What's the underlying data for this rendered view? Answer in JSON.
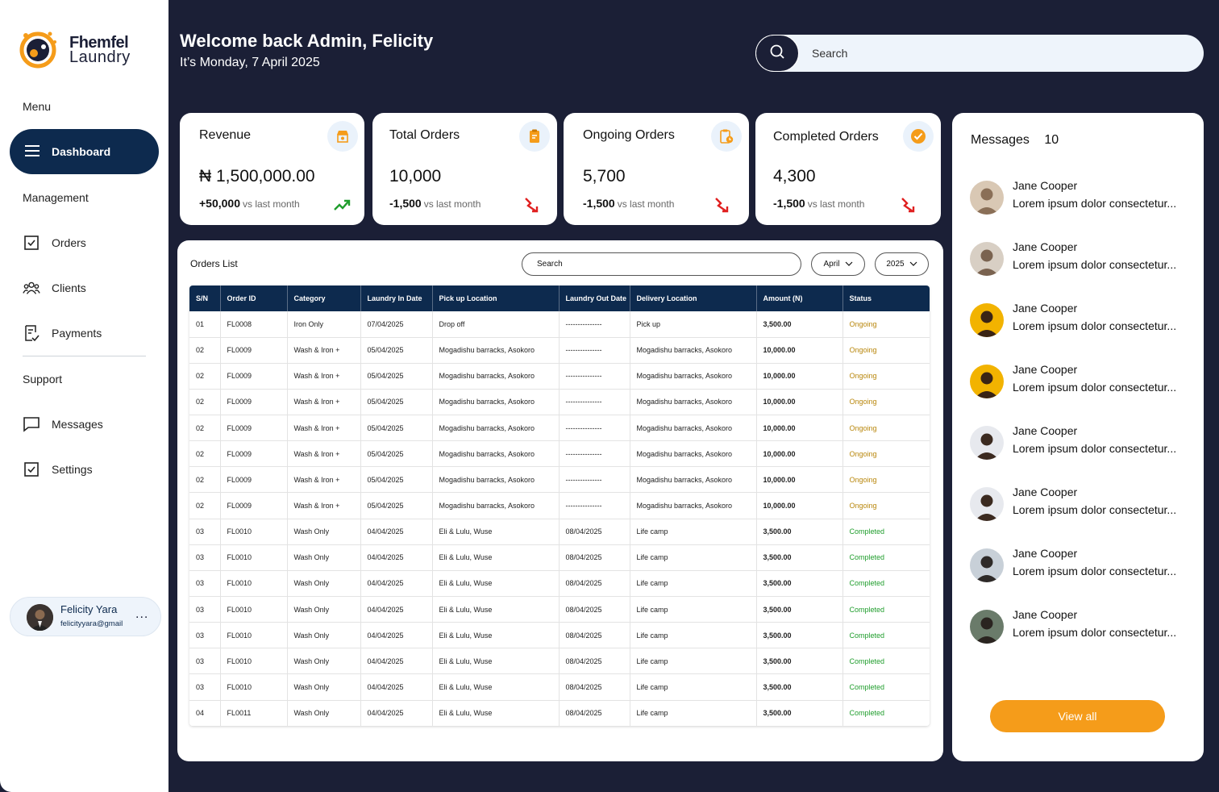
{
  "brand": {
    "line1": "Fhemfel",
    "line2": "Laundry"
  },
  "sidebar": {
    "menu_label": "Menu",
    "dashboard_label": "Dashboard",
    "management_label": "Management",
    "orders_label": "Orders",
    "clients_label": "Clients",
    "payments_label": "Payments",
    "support_label": "Support",
    "messages_label": "Messages",
    "settings_label": "Settings"
  },
  "user": {
    "name": "Felicity Yara",
    "email": "felicityyara@gmail",
    "more": "..."
  },
  "header": {
    "welcome": "Welcome back Admin, Felicity",
    "date": "It’s Monday, 7 April 2025",
    "search_placeholder": "Search"
  },
  "stats": [
    {
      "title": "Revenue",
      "value": "₦ 1,500,000.00",
      "delta": "+50,000",
      "vs": "vs last month",
      "trend": "up",
      "icon": "shop-icon"
    },
    {
      "title": "Total Orders",
      "value": "10,000",
      "delta": "-1,500",
      "vs": "vs last month",
      "trend": "down",
      "icon": "clipboard-icon"
    },
    {
      "title": "Ongoing Orders",
      "value": "5,700",
      "delta": "-1,500",
      "vs": "vs last month",
      "trend": "down",
      "icon": "clipboard-clock-icon"
    },
    {
      "title": "Completed Orders",
      "value": "4,300",
      "delta": "-1,500",
      "vs": "vs last month",
      "trend": "down",
      "icon": "check-circle-icon"
    }
  ],
  "orders": {
    "title": "Orders List",
    "search_placeholder": "Search",
    "month": "April",
    "year": "2025",
    "columns": [
      "S/N",
      "Order ID",
      "Category",
      "Laundry In Date",
      "Pick up Location",
      "Laundry Out Date",
      "Delivery Location",
      "Amount (N)",
      "Status"
    ],
    "rows": [
      [
        "01",
        "FL0008",
        "Iron Only",
        "07/04/2025",
        "Drop off",
        "---------------",
        "Pick up",
        "3,500.00",
        "Ongoing"
      ],
      [
        "02",
        "FL0009",
        "Wash & Iron +",
        "05/04/2025",
        "Mogadishu barracks, Asokoro",
        "---------------",
        "Mogadishu barracks, Asokoro",
        "10,000.00",
        "Ongoing"
      ],
      [
        "02",
        "FL0009",
        "Wash & Iron +",
        "05/04/2025",
        "Mogadishu barracks, Asokoro",
        "---------------",
        "Mogadishu barracks, Asokoro",
        "10,000.00",
        "Ongoing"
      ],
      [
        "02",
        "FL0009",
        "Wash & Iron +",
        "05/04/2025",
        "Mogadishu barracks, Asokoro",
        "---------------",
        "Mogadishu barracks, Asokoro",
        "10,000.00",
        "Ongoing"
      ],
      [
        "02",
        "FL0009",
        "Wash & Iron +",
        "05/04/2025",
        "Mogadishu barracks, Asokoro",
        "---------------",
        "Mogadishu barracks, Asokoro",
        "10,000.00",
        "Ongoing"
      ],
      [
        "02",
        "FL0009",
        "Wash & Iron +",
        "05/04/2025",
        "Mogadishu barracks, Asokoro",
        "---------------",
        "Mogadishu barracks, Asokoro",
        "10,000.00",
        "Ongoing"
      ],
      [
        "02",
        "FL0009",
        "Wash & Iron +",
        "05/04/2025",
        "Mogadishu barracks, Asokoro",
        "---------------",
        "Mogadishu barracks, Asokoro",
        "10,000.00",
        "Ongoing"
      ],
      [
        "02",
        "FL0009",
        "Wash & Iron +",
        "05/04/2025",
        "Mogadishu barracks, Asokoro",
        "---------------",
        "Mogadishu barracks, Asokoro",
        "10,000.00",
        "Ongoing"
      ],
      [
        "03",
        "FL0010",
        "Wash Only",
        "04/04/2025",
        "Eli & Lulu, Wuse",
        "08/04/2025",
        "Life camp",
        "3,500.00",
        "Completed"
      ],
      [
        "03",
        "FL0010",
        "Wash Only",
        "04/04/2025",
        "Eli & Lulu, Wuse",
        "08/04/2025",
        "Life camp",
        "3,500.00",
        "Completed"
      ],
      [
        "03",
        "FL0010",
        "Wash Only",
        "04/04/2025",
        "Eli & Lulu, Wuse",
        "08/04/2025",
        "Life camp",
        "3,500.00",
        "Completed"
      ],
      [
        "03",
        "FL0010",
        "Wash Only",
        "04/04/2025",
        "Eli & Lulu, Wuse",
        "08/04/2025",
        "Life camp",
        "3,500.00",
        "Completed"
      ],
      [
        "03",
        "FL0010",
        "Wash Only",
        "04/04/2025",
        "Eli & Lulu, Wuse",
        "08/04/2025",
        "Life camp",
        "3,500.00",
        "Completed"
      ],
      [
        "03",
        "FL0010",
        "Wash Only",
        "04/04/2025",
        "Eli & Lulu, Wuse",
        "08/04/2025",
        "Life camp",
        "3,500.00",
        "Completed"
      ],
      [
        "03",
        "FL0010",
        "Wash Only",
        "04/04/2025",
        "Eli & Lulu, Wuse",
        "08/04/2025",
        "Life camp",
        "3,500.00",
        "Completed"
      ],
      [
        "04",
        "FL0011",
        "Wash Only",
        "04/04/2025",
        "Eli & Lulu, Wuse",
        "08/04/2025",
        "Life camp",
        "3,500.00",
        "Completed"
      ]
    ]
  },
  "messages": {
    "title": "Messages",
    "count": "10",
    "items": [
      {
        "name": "Jane Cooper",
        "text": "Lorem ipsum dolor consectetur..."
      },
      {
        "name": "Jane Cooper",
        "text": "Lorem ipsum dolor consectetur..."
      },
      {
        "name": "Jane Cooper",
        "text": "Lorem ipsum dolor consectetur..."
      },
      {
        "name": "Jane Cooper",
        "text": "Lorem ipsum dolor consectetur..."
      },
      {
        "name": "Jane Cooper",
        "text": "Lorem ipsum dolor consectetur..."
      },
      {
        "name": "Jane Cooper",
        "text": "Lorem ipsum dolor consectetur..."
      },
      {
        "name": "Jane Cooper",
        "text": "Lorem ipsum dolor consectetur..."
      },
      {
        "name": "Jane Cooper",
        "text": "Lorem ipsum dolor consectetur..."
      }
    ],
    "view_all": "View all"
  },
  "colors": {
    "navy": "#0d2a4e",
    "background": "#1b1f36",
    "accent": "#f59c1a",
    "ongoing": "#b8860b",
    "completed": "#1f9d2c",
    "trend_up": "#1f9d2c",
    "trend_down": "#e02020"
  }
}
